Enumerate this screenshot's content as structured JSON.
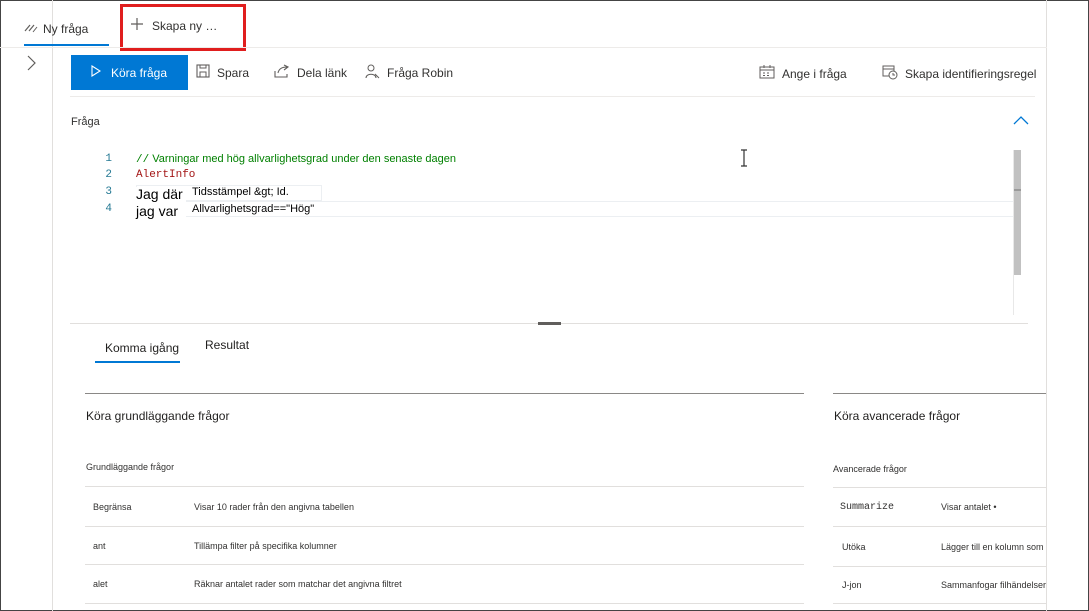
{
  "tabs": {
    "active_label": "Ny fråga",
    "new_label": "Skapa ny"
  },
  "toolbar": {
    "run_label": "Köra fråga",
    "save_label": "Spara",
    "share_label": "Dela länk",
    "robin_label": "Fråga Robin",
    "schedule_label": "Ange i fråga",
    "detection_label": "Skapa identifieringsregel"
  },
  "editor": {
    "section_label": "Fråga",
    "lines": [
      {
        "num": "1",
        "slashes": "//",
        "text": " Varningar med hög allvarlighetsgrad under den senaste dagen"
      },
      {
        "num": "2",
        "text": "AlertInfo"
      },
      {
        "num": "3",
        "keyword": "Jag där",
        "text": "Tidsstämpel &gt; Id."
      },
      {
        "num": "4",
        "keyword": "jag var",
        "text": "Allvarlighetsgrad==\"Hög\""
      }
    ]
  },
  "result_tabs": {
    "get_started": "Komma igång",
    "results": "Resultat"
  },
  "basic": {
    "title": "Köra grundläggande frågor",
    "subtitle": "Grundläggande frågor",
    "rows": [
      {
        "op": "Begränsa",
        "desc": "Visar 10 rader från den angivna tabellen"
      },
      {
        "op": "ant",
        "desc": "Tillämpa filter på specifika kolumner"
      },
      {
        "op": "alet",
        "desc": "Räknar antalet rader som matchar det angivna filtret"
      }
    ]
  },
  "advanced": {
    "title": "Köra avancerade frågor",
    "subtitle": "Avancerade frågor",
    "rows": [
      {
        "op": "Summarize",
        "desc": "Visar antalet •"
      },
      {
        "op": "Utöka",
        "desc": "Lägger till en kolumn som cc"
      },
      {
        "op": "J-jon",
        "desc": "Sammanfogar filhändelser och"
      }
    ]
  },
  "colors": {
    "accent": "#0078d4",
    "highlight": "#e01e1e",
    "comment": "#008000",
    "table_name": "#a31515",
    "line_number": "#237893"
  }
}
